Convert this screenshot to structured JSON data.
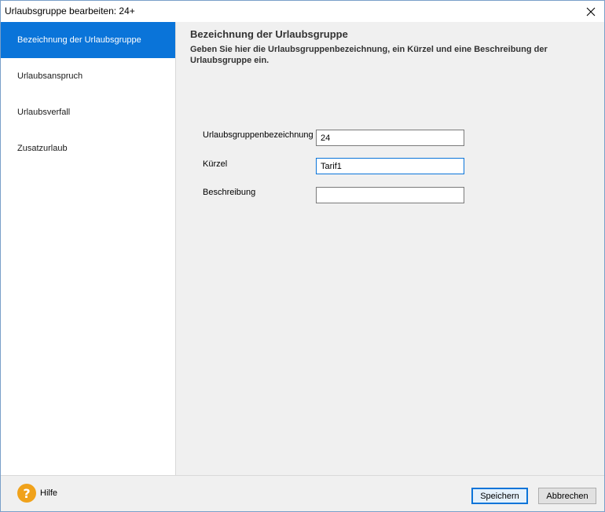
{
  "window": {
    "title": "Urlaubsgruppe bearbeiten: 24+"
  },
  "sidebar": {
    "items": [
      {
        "label": "Bezeichnung der Urlaubsgruppe",
        "active": true
      },
      {
        "label": "Urlaubsanspruch",
        "active": false
      },
      {
        "label": "Urlaubsverfall",
        "active": false
      },
      {
        "label": "Zusatzurlaub",
        "active": false
      }
    ]
  },
  "main": {
    "title": "Bezeichnung der Urlaubsgruppe",
    "description": "Geben Sie hier die Urlaubsgruppenbezeichnung, ein Kürzel und eine Beschreibung der Urlaubsgruppe ein.",
    "fields": {
      "name": {
        "label": "Urlaubsgruppenbezeichnung",
        "value": "24"
      },
      "short": {
        "label": "Kürzel",
        "value": "Tarif1"
      },
      "description": {
        "label": "Beschreibung",
        "value": ""
      }
    }
  },
  "footer": {
    "help_label": "Hilfe",
    "help_icon": "question-icon",
    "save_label": "Speichern",
    "cancel_label": "Abbrechen"
  },
  "colors": {
    "accent": "#0a74d9",
    "help_icon": "#f0a21b"
  }
}
